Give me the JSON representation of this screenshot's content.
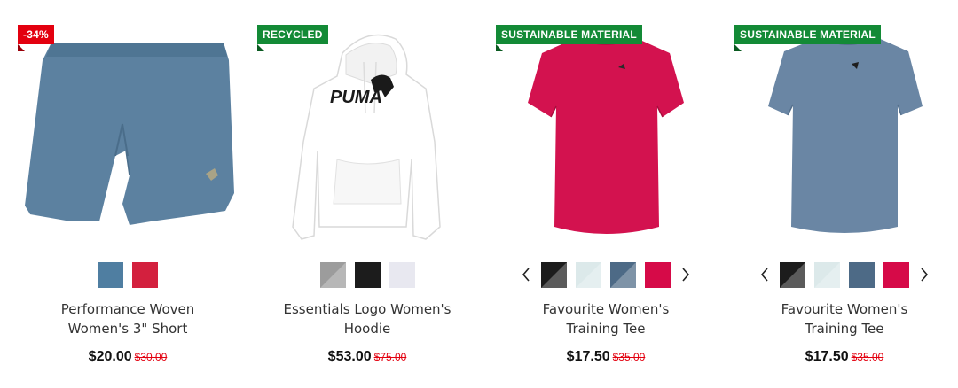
{
  "products": [
    {
      "badge": "-34%",
      "badge_color": "#e3000f",
      "image_icon": "shorts-icon",
      "product_color": "#5c81a0",
      "swatches": [
        "#4f7ea1",
        "#d3203e"
      ],
      "name_line1": "Performance Woven",
      "name_line2": "Women's 3\" Short",
      "price": "$20.00",
      "original_price": "$30.00"
    },
    {
      "badge": "RECYCLED",
      "badge_color": "#138a36",
      "image_icon": "hoodie-icon",
      "product_color": "#ffffff",
      "logo_text": "PUMA",
      "swatches": [
        "#9c9c9c",
        "#1c1c1c",
        "#e8e8f0"
      ],
      "name_line1": "Essentials Logo Women's",
      "name_line2": "Hoodie",
      "price": "$53.00",
      "original_price": "$75.00"
    },
    {
      "badge": "SUSTAINABLE MATERIAL",
      "badge_color": "#138a36",
      "image_icon": "tee-icon",
      "product_color": "#d3124f",
      "swatches": [
        "#1c1c1c",
        "#dce9ea",
        "#4d6a86",
        "#d60a48"
      ],
      "name_line1": "Favourite Women's",
      "name_line2": "Training Tee",
      "price": "$17.50",
      "original_price": "$35.00"
    },
    {
      "badge": "SUSTAINABLE MATERIAL",
      "badge_color": "#138a36",
      "image_icon": "tee-icon",
      "product_color": "#6a86a4",
      "swatches": [
        "#1c1c1c",
        "#dce9ea",
        "#4d6a86",
        "#d60a48"
      ],
      "name_line1": "Favourite Women's",
      "name_line2": "Training Tee",
      "price": "$17.50",
      "original_price": "$35.00"
    }
  ]
}
